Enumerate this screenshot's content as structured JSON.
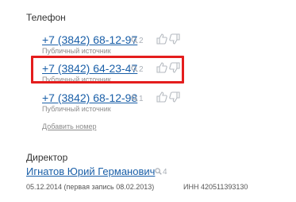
{
  "phone_section": {
    "title": "Телефон",
    "add_label": "Добавить номер",
    "entries": [
      {
        "number": "+7 (3842) 68-12-97",
        "count": "2",
        "source": "Публичный источник"
      },
      {
        "number": "+7 (3842) 64-23-47",
        "count": "2",
        "source": "Публичный источник"
      },
      {
        "number": "+7 (3842) 68-12-98",
        "count": "1",
        "source": "Публичный источник"
      }
    ]
  },
  "director_section": {
    "title": "Директор",
    "name": "Игнатов Юрий Германович",
    "count": "4",
    "date_text": "05.12.2014 (первая запись 08.02.2013)",
    "inn_text": "ИНН 420511393130"
  },
  "colors": {
    "link": "#1a5fa8",
    "highlight": "#e41d1d",
    "muted": "#8c8c8c"
  }
}
